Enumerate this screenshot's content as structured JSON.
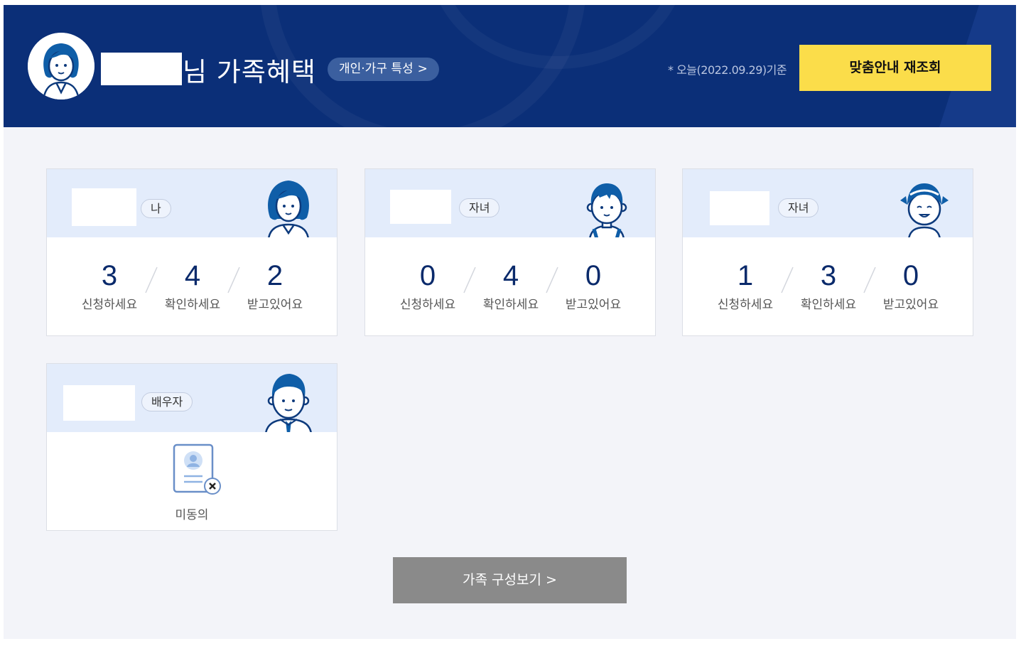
{
  "header": {
    "title_suffix": "님 가족혜택",
    "household_button": "개인·가구 특성",
    "household_button_arrow": ">",
    "date_note": "* 오늘(2022.09.29)기준",
    "requery_button": "맞춤안내 재조회",
    "avatar_icon": "woman-avatar-icon"
  },
  "cards": [
    {
      "relation": "나",
      "character_icon": "woman-character-icon",
      "stats": [
        {
          "value": "3",
          "label": "신청하세요"
        },
        {
          "value": "4",
          "label": "확인하세요"
        },
        {
          "value": "2",
          "label": "받고있어요"
        }
      ]
    },
    {
      "relation": "자녀",
      "character_icon": "boy-character-icon",
      "stats": [
        {
          "value": "0",
          "label": "신청하세요"
        },
        {
          "value": "4",
          "label": "확인하세요"
        },
        {
          "value": "0",
          "label": "받고있어요"
        }
      ]
    },
    {
      "relation": "자녀",
      "character_icon": "girl-character-icon",
      "stats": [
        {
          "value": "1",
          "label": "신청하세요"
        },
        {
          "value": "3",
          "label": "확인하세요"
        },
        {
          "value": "0",
          "label": "받고있어요"
        }
      ]
    },
    {
      "relation": "배우자",
      "character_icon": "man-character-icon",
      "status_icon": "no-consent-id-card-icon",
      "status_label": "미동의"
    }
  ],
  "footer": {
    "family_button": "가족 구성보기 >"
  },
  "colors": {
    "header_bg": "#0b2f78",
    "requery_button_bg": "#fbdd4a",
    "card_top_bg": "#e3ecfb",
    "number_color": "#0a2a6b",
    "family_button_bg": "#8a8a8a"
  }
}
